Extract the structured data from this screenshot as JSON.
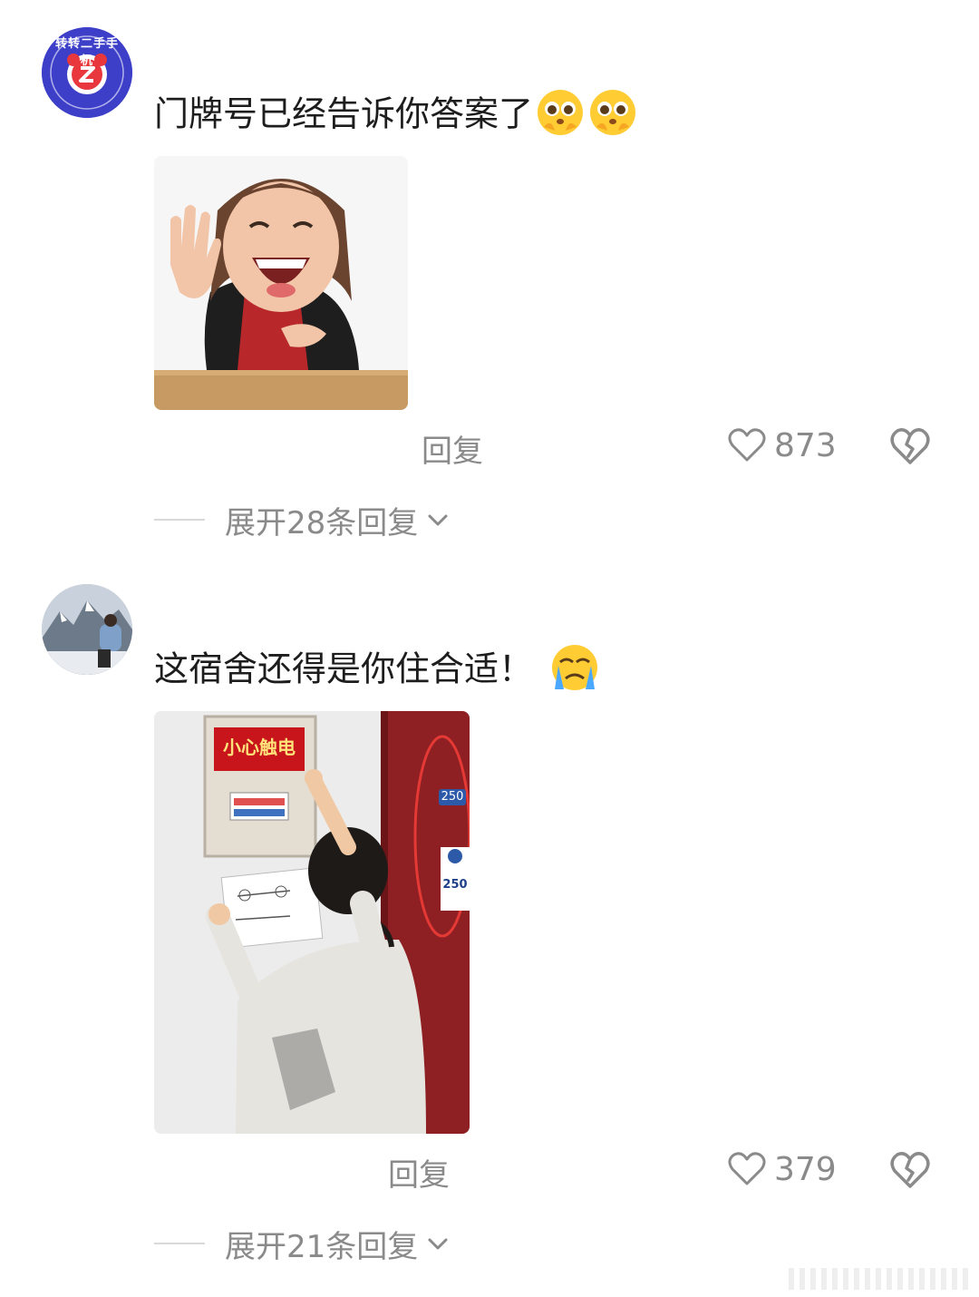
{
  "comments": [
    {
      "avatar_text": "转转二手手机",
      "text": "门牌号已经告诉你答案了",
      "emoji": [
        "holding-back-tears-emoji",
        "holding-back-tears-emoji"
      ],
      "reply_label": "回复",
      "likes": "873",
      "expand_label": "展开28条回复"
    },
    {
      "text": "这宿舍还得是你住合适！",
      "emoji": [
        "crying-emoji"
      ],
      "sign_text": "小心触电",
      "door_number": "250",
      "plate_number": "250",
      "reply_label": "回复",
      "likes": "379",
      "expand_label": "展开21条回复"
    }
  ],
  "colors": {
    "text": "#1d1d1d",
    "muted": "#8a8a8a",
    "avatar_blue": "#3d3fc9",
    "avatar_red": "#e8383d",
    "sign_red": "#c8141b",
    "door_red": "#8e1f22"
  }
}
